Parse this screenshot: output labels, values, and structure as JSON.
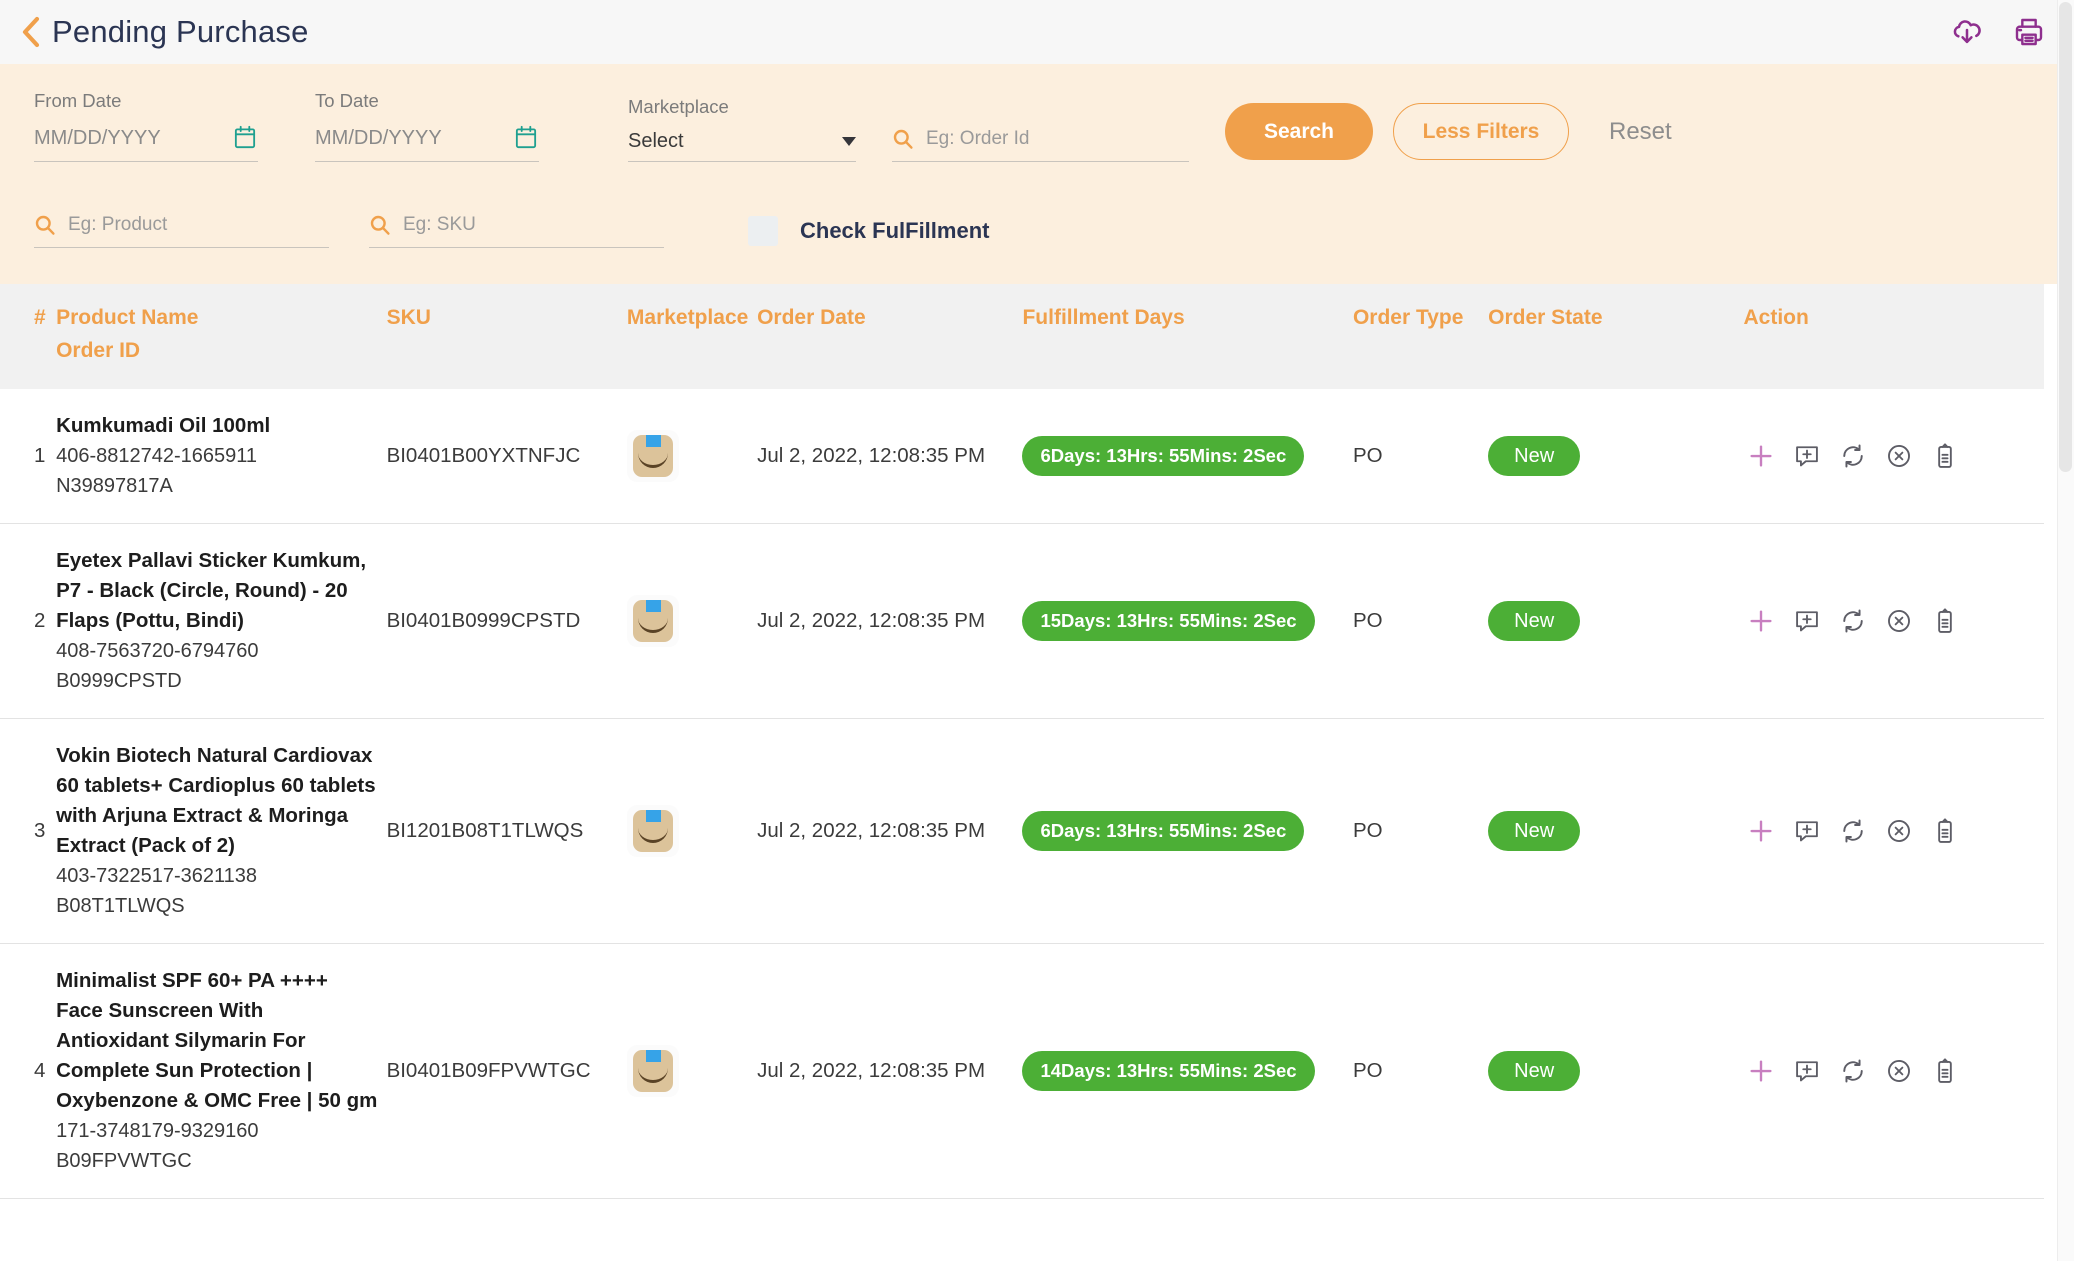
{
  "header": {
    "back_icon": "chevron-left-icon",
    "title": "Pending Purchase",
    "download_icon": "cloud-download-icon",
    "print_icon": "printer-icon"
  },
  "filters": {
    "from_date": {
      "label": "From Date",
      "value": "",
      "placeholder": "MM/DD/YYYY",
      "icon": "calendar-icon"
    },
    "to_date": {
      "label": "To Date",
      "value": "",
      "placeholder": "MM/DD/YYYY",
      "icon": "calendar-icon"
    },
    "marketplace": {
      "label": "Marketplace",
      "selected": "Select",
      "caret_icon": "chevron-down-icon"
    },
    "order_id": {
      "placeholder": "Eg: Order Id",
      "value": "",
      "icon": "search-icon"
    },
    "product": {
      "placeholder": "Eg: Product",
      "value": "",
      "icon": "search-icon"
    },
    "sku": {
      "placeholder": "Eg: SKU",
      "value": "",
      "icon": "search-icon"
    },
    "check_fulfillment": {
      "label": "Check FulFillment",
      "checked": false
    },
    "search_button": "Search",
    "less_filters_button": "Less Filters",
    "reset_button": "Reset"
  },
  "table": {
    "columns": {
      "index": "#",
      "product_name": "Product Name",
      "order_id": "Order ID",
      "sku": "SKU",
      "marketplace": "Marketplace",
      "order_date": "Order Date",
      "fulfillment_days": "Fulfillment Days",
      "order_type": "Order Type",
      "order_state": "Order State",
      "action": "Action"
    },
    "rows": [
      {
        "index": "1",
        "product_name": "Kumkumadi Oil 100ml",
        "order_id": "406-8812742-1665911",
        "order_ref": "N39897817A",
        "sku": "BI0401B00YXTNFJC",
        "marketplace_icon": "amazon-box-icon",
        "order_date": "Jul 2, 2022, 12:08:35 PM",
        "fulfillment_days": "6Days: 13Hrs: 55Mins: 2Sec",
        "order_type": "PO",
        "order_state": "New"
      },
      {
        "index": "2",
        "product_name": "Eyetex Pallavi Sticker Kumkum, P7 - Black (Circle, Round) - 20 Flaps (Pottu, Bindi)",
        "order_id": "408-7563720-6794760",
        "order_ref": "B0999CPSTD",
        "sku": "BI0401B0999CPSTD",
        "marketplace_icon": "amazon-box-icon",
        "order_date": "Jul 2, 2022, 12:08:35 PM",
        "fulfillment_days": "15Days: 13Hrs: 55Mins: 2Sec",
        "order_type": "PO",
        "order_state": "New"
      },
      {
        "index": "3",
        "product_name": "Vokin Biotech Natural Cardiovax 60 tablets+ Cardioplus 60 tablets with Arjuna Extract & Moringa Extract (Pack of 2)",
        "order_id": "403-7322517-3621138",
        "order_ref": "B08T1TLWQS",
        "sku": "BI1201B08T1TLWQS",
        "marketplace_icon": "amazon-box-icon",
        "order_date": "Jul 2, 2022, 12:08:35 PM",
        "fulfillment_days": "6Days: 13Hrs: 55Mins: 2Sec",
        "order_type": "PO",
        "order_state": "New"
      },
      {
        "index": "4",
        "product_name": "Minimalist SPF 60+ PA ++++ Face Sunscreen With Antioxidant Silymarin For Complete Sun Protection | Oxybenzone & OMC Free | 50 gm",
        "order_id": "171-3748179-9329160",
        "order_ref": "B09FPVWTGC",
        "sku": "BI0401B09FPVWTGC",
        "marketplace_icon": "amazon-box-icon",
        "order_date": "Jul 2, 2022, 12:08:35 PM",
        "fulfillment_days": "14Days: 13Hrs: 55Mins: 2Sec",
        "order_type": "PO",
        "order_state": "New"
      }
    ],
    "row_actions": [
      "plus-icon",
      "add-comment-icon",
      "refresh-icon",
      "cancel-circle-icon",
      "clipboard-icon"
    ]
  },
  "colors": {
    "accent_orange": "#f0a04b",
    "filter_bg": "#fcefde",
    "title_navy": "#2b3553",
    "badge_green": "#4caf36",
    "icon_purple": "#8e2f8e",
    "calendar_teal": "#1fa090",
    "action_pink": "#c87fc0"
  }
}
